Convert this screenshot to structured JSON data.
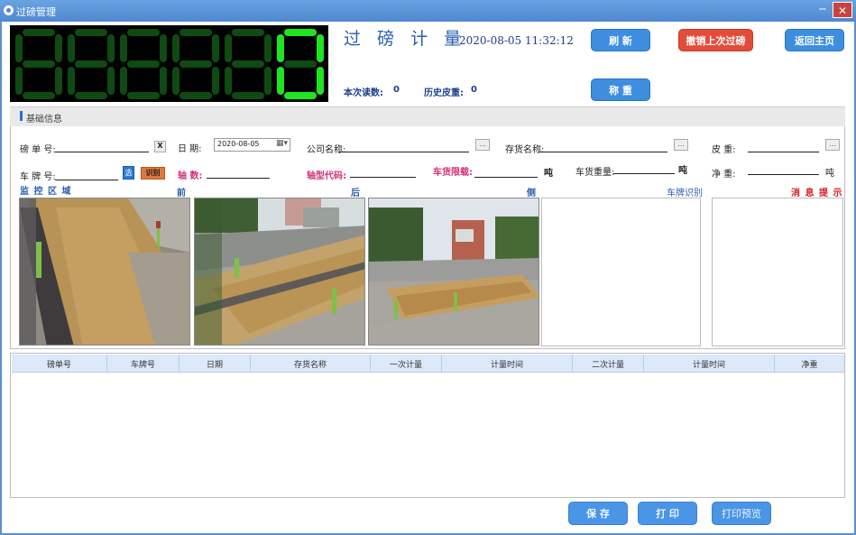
{
  "window": {
    "title": "过磅管理"
  },
  "display": {
    "digits": [
      8,
      8,
      8,
      8,
      8,
      0
    ]
  },
  "header": {
    "title": "过 磅 计 量",
    "datetime": "2020-08-05 11:32:12",
    "reading_label": "本次读数:",
    "reading_value": "0",
    "history_tare_label": "历史皮重:",
    "history_tare_value": "0"
  },
  "buttons": {
    "refresh": "刷 新",
    "undo_last": "撤销上次过磅",
    "back_home": "返回主页",
    "weigh": "称 重",
    "save": "保 存",
    "print": "打 印",
    "print_preview": "打印预览"
  },
  "info": {
    "section_title": "基础信息",
    "ticket_no_label": "磅 单 号:",
    "ticket_clear": "X",
    "date_label": "日    期:",
    "date_value": "2020-08-05",
    "company_label": "公司名称:",
    "goods_label": "存货名称:",
    "tare_label": "皮    重:",
    "plate_label": "车 牌 号:",
    "plate_select": "选",
    "plate_recognize": "识别",
    "axle_label": "轴 数:",
    "axle_code_label": "轴型代码:",
    "limit_label": "车货限载:",
    "limit_unit": "吨",
    "gross_label": "车货重量:",
    "gross_unit": "吨",
    "net_label": "净    重:",
    "net_unit": "吨",
    "dots": "..."
  },
  "monitor": {
    "area_label": "监 控 区 域",
    "front": "前",
    "back": "后",
    "side": "侧",
    "plate_recog": "车牌识别",
    "messages": "消 息 提 示"
  },
  "table": {
    "columns": [
      "磅单号",
      "车牌号",
      "日期",
      "存货名称",
      "一次计量",
      "计量时间",
      "二次计量",
      "计量时间",
      "净重"
    ]
  },
  "colors": {
    "segment_on": "#1fe521",
    "segment_off": "#0f4a12",
    "accent": "#3e8ee0",
    "danger": "#e24d3b"
  }
}
